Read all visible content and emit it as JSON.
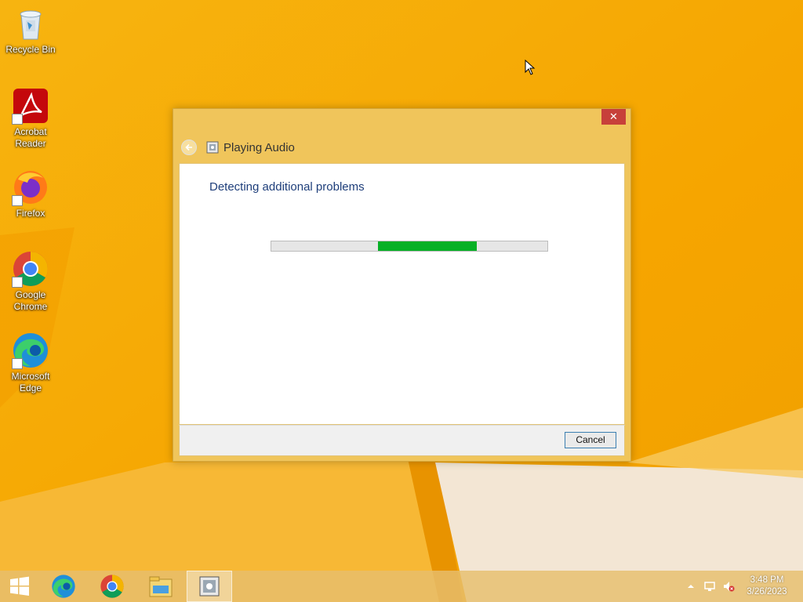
{
  "desktop": {
    "icons": [
      {
        "label": "Recycle Bin"
      },
      {
        "label": "Acrobat Reader"
      },
      {
        "label": "Firefox"
      },
      {
        "label": "Google Chrome"
      },
      {
        "label": "Microsoft Edge"
      }
    ]
  },
  "dialog": {
    "title": "Playing Audio",
    "heading": "Detecting additional problems",
    "close_label": "✕",
    "cancel_label": "Cancel",
    "progress": {
      "indeterminate": true,
      "segment_start_pct": 38.5,
      "segment_width_pct": 36
    }
  },
  "taskbar": {
    "items": [
      {
        "icon": "windows-start-icon"
      },
      {
        "icon": "edge-icon"
      },
      {
        "icon": "chrome-icon"
      },
      {
        "icon": "file-explorer-icon"
      },
      {
        "icon": "troubleshooter-icon",
        "active": true
      }
    ],
    "clock": {
      "time": "3:48 PM",
      "date": "3/26/2023"
    },
    "tray": [
      "show-hidden-icons-icon",
      "network-icon",
      "volume-muted-icon"
    ]
  },
  "colors": {
    "wallpaper": "#f5a800",
    "window_frame": "#f0c55b",
    "close_button": "#c7403a",
    "heading_text": "#1e3e7a",
    "progress_fill": "#06b025"
  }
}
